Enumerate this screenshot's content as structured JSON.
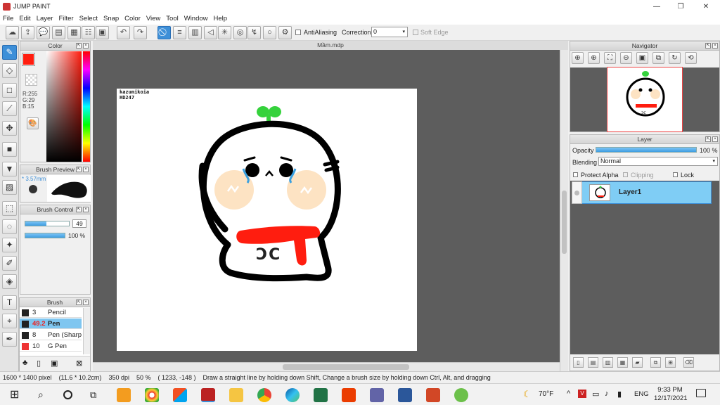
{
  "window": {
    "title": "JUMP PAINT",
    "minimize": "—",
    "restore": "❐",
    "close": "✕"
  },
  "menu": [
    "File",
    "Edit",
    "Layer",
    "Filter",
    "Select",
    "Snap",
    "Color",
    "View",
    "Tool",
    "Window",
    "Help"
  ],
  "toolbar": {
    "antialiasing_label": "AntiAliasing",
    "correction_label": "Correction",
    "correction_value": "0",
    "soft_edge_label": "Soft Edge"
  },
  "color_panel": {
    "title": "Color",
    "r": "R:255",
    "g": "G:29",
    "b": "B:15",
    "current_color": "#ff1d0f"
  },
  "brush_preview": {
    "title": "Brush Preview",
    "size": "* 3.57mm"
  },
  "brush_control": {
    "title": "Brush Control",
    "size_value": "49",
    "opacity_value": "100 %",
    "size_fraction": 0.49,
    "opacity_fraction": 1.0
  },
  "brush_list": {
    "title": "Brush",
    "items": [
      {
        "size": "3",
        "name": "Pencil",
        "color": "#222222",
        "selected": false
      },
      {
        "size": "49.2",
        "name": "Pen",
        "color": "#222222",
        "selected": true
      },
      {
        "size": "8",
        "name": "Pen (Sharp)",
        "color": "#222222",
        "selected": false
      },
      {
        "size": "10",
        "name": "G Pen",
        "color": "#ee3333",
        "selected": false
      }
    ]
  },
  "document": {
    "tab": "Mầm.mdp",
    "signature": "kazumikoia\nHD247",
    "shirt_text": "ƆC"
  },
  "navigator": {
    "title": "Navigator"
  },
  "layer_panel": {
    "title": "Layer",
    "opacity_label": "Opacity",
    "opacity_value": "100 %",
    "opacity_fraction": 1.0,
    "blending_label": "Blending",
    "blending_value": "Normal",
    "protect_alpha": "Protect Alpha",
    "clipping": "Clipping",
    "lock": "Lock",
    "layers": [
      {
        "name": "Layer1"
      }
    ]
  },
  "status": {
    "pixels": "1600 * 1400 pixel",
    "physical": "(11.6 * 10.2cm)",
    "dpi": "350 dpi",
    "zoom": "50 %",
    "coords": "( 1233, -148 )",
    "hint": "Draw a straight line by holding down Shift, Change a brush size by holding down Ctrl, Alt, and dragging"
  },
  "taskbar": {
    "temperature": "70°F",
    "language": "ENG",
    "time": "9:33 PM",
    "date": "12/17/2021"
  },
  "colors": {
    "accent": "#3d8fd8",
    "scarf": "#ff1d0f",
    "sprout": "#35d23c",
    "cheek": "#fde3c3",
    "canvas_bg": "#5d5d5d"
  }
}
